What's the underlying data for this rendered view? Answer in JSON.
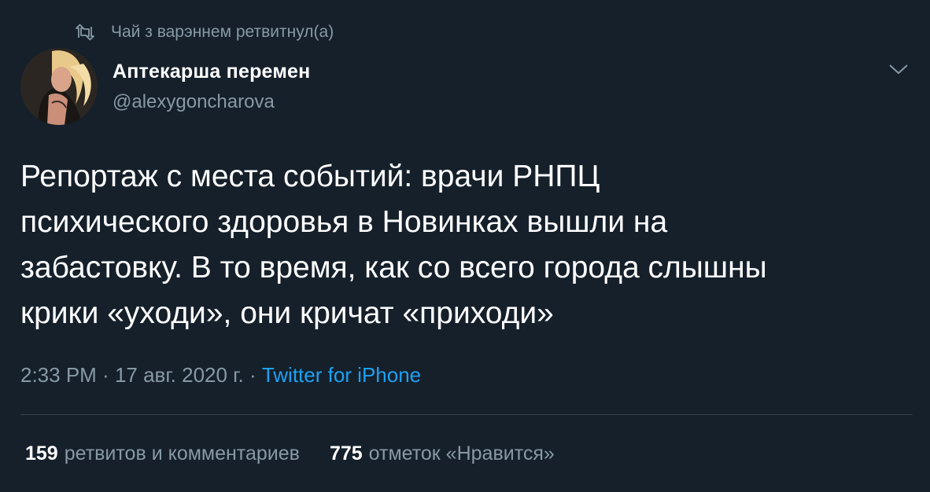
{
  "retweet": {
    "icon": "retweet-icon",
    "text": "Чай з варэннем ретвитнул(а)"
  },
  "author": {
    "display_name": "Аптекарша перемен",
    "handle": "@alexygoncharova",
    "avatar_icon": "avatar-photo"
  },
  "menu": {
    "icon": "chevron-down-icon"
  },
  "tweet": {
    "lines": [
      "Репортаж с места событий: врачи РНПЦ",
      "психического здоровья в Новинках вышли на",
      "забастовку. В то время, как со всего города слышны",
      "крики «уходи», они кричат «приходи»"
    ]
  },
  "meta": {
    "time": "2:33 PM",
    "sep1": " · ",
    "date": "17 авг. 2020 г.",
    "sep2": " · ",
    "source": "Twitter for iPhone"
  },
  "stats": {
    "retweets_count": "159",
    "retweets_label": "ретвитов и комментариев",
    "likes_count": "775",
    "likes_label": "отметок «Нравится»"
  },
  "colors": {
    "background": "#15202b",
    "secondary_text": "#8899a6",
    "link": "#1da1f2",
    "divider": "#38444d"
  }
}
